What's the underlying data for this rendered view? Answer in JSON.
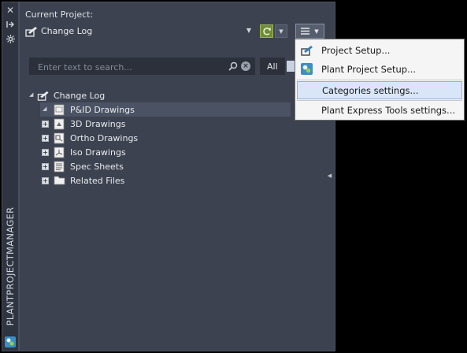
{
  "strip": {
    "title": "PLANTPROJECTMANAGER",
    "buttons": [
      "close-icon",
      "pin-icon",
      "settings-icon"
    ]
  },
  "header": {
    "current_project_label": "Current Project:",
    "project_name": "Change Log"
  },
  "search": {
    "placeholder": "Enter text to search...",
    "value": "",
    "filter_label": "All"
  },
  "tree": {
    "root": "Change Log",
    "items": [
      {
        "label": "P&ID Drawings",
        "state": "expanded",
        "selected": true
      },
      {
        "label": "3D Drawings",
        "state": "collapsed"
      },
      {
        "label": "Ortho Drawings",
        "state": "collapsed"
      },
      {
        "label": "Iso Drawings",
        "state": "collapsed"
      },
      {
        "label": "Spec Sheets",
        "state": "collapsed"
      },
      {
        "label": "Related Files",
        "state": "collapsed"
      }
    ]
  },
  "menu": {
    "items": [
      {
        "label": "Project Setup...",
        "icon": "project-setup-icon"
      },
      {
        "label": "Plant Project Setup...",
        "icon": "plant-project-setup-icon"
      },
      {
        "label": "Categories settings...",
        "icon": "",
        "highlighted": true
      },
      {
        "label": "Plant Express Tools settings...",
        "icon": ""
      }
    ]
  },
  "colors": {
    "panel": "#3c4250",
    "selected_row": "#4b5263",
    "menu_highlight": "#d9e6f7",
    "refresh_green": "#6f8c3a"
  }
}
